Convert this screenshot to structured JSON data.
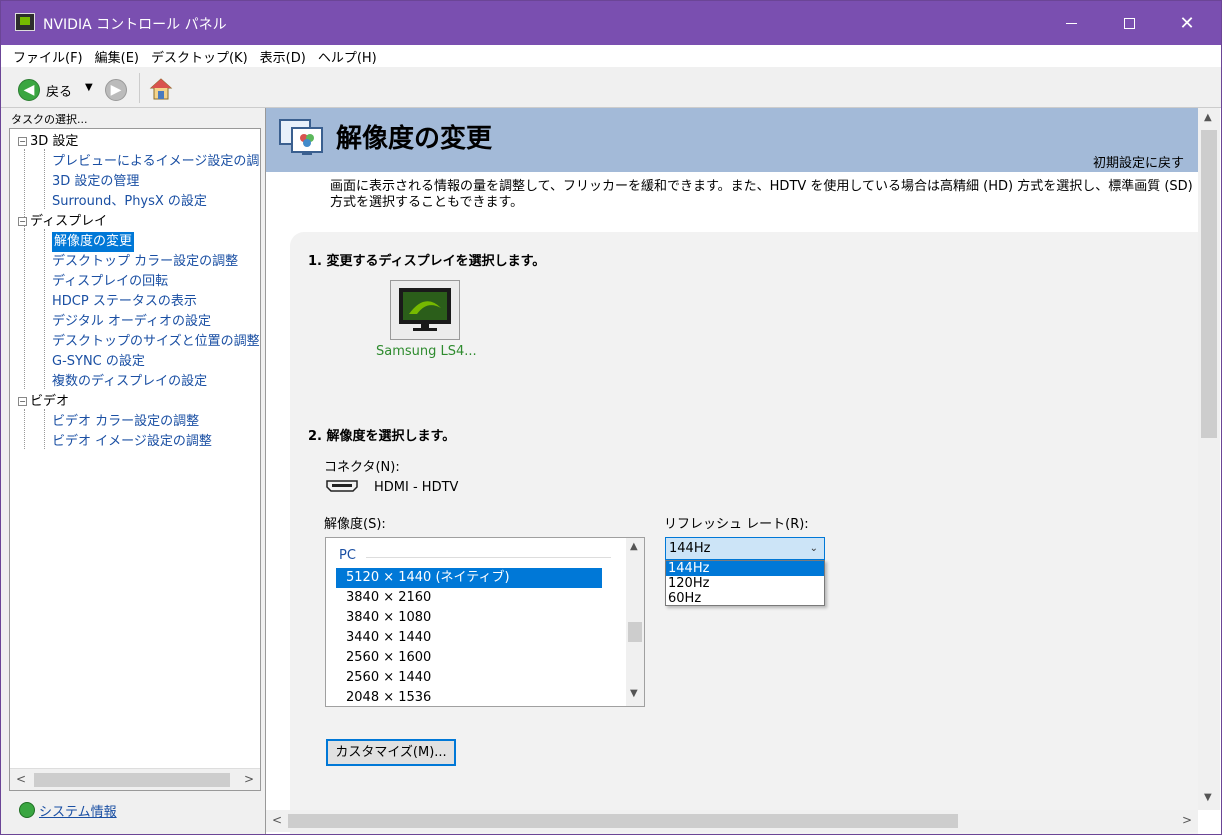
{
  "window": {
    "title": "NVIDIA コントロール パネル",
    "close_glyph": "✕"
  },
  "menu": [
    "ファイル(F)",
    "編集(E)",
    "デスクトップ(K)",
    "表示(D)",
    "ヘルプ(H)"
  ],
  "toolbar": {
    "back_label": "戻る"
  },
  "tasks": {
    "label": "タスクの選択...",
    "tree": [
      {
        "label": "3D 設定",
        "type": "category"
      },
      {
        "label": "プレビューによるイメージ設定の調整",
        "type": "link"
      },
      {
        "label": "3D 設定の管理",
        "type": "link"
      },
      {
        "label": "Surround、PhysX の設定",
        "type": "link"
      },
      {
        "label": "ディスプレイ",
        "type": "category"
      },
      {
        "label": "解像度の変更",
        "type": "link",
        "selected": true
      },
      {
        "label": "デスクトップ カラー設定の調整",
        "type": "link"
      },
      {
        "label": "ディスプレイの回転",
        "type": "link"
      },
      {
        "label": "HDCP ステータスの表示",
        "type": "link"
      },
      {
        "label": "デジタル オーディオの設定",
        "type": "link"
      },
      {
        "label": "デスクトップのサイズと位置の調整",
        "type": "link"
      },
      {
        "label": "G-SYNC の設定",
        "type": "link"
      },
      {
        "label": "複数のディスプレイの設定",
        "type": "link"
      },
      {
        "label": "ビデオ",
        "type": "category"
      },
      {
        "label": "ビデオ カラー設定の調整",
        "type": "link"
      },
      {
        "label": "ビデオ イメージ設定の調整",
        "type": "link"
      }
    ],
    "system_info": "システム情報"
  },
  "page": {
    "title": "解像度の変更",
    "reset_link": "初期設定に戻す",
    "description": "画面に表示される情報の量を調整して、フリッカーを緩和できます。また、HDTV を使用している場合は高精細 (HD) 方式を選択し、標準画質 (SD) 方式を選択することもできます。",
    "step1": "1. 変更するディスプレイを選択します。",
    "display_name": "Samsung LS4...",
    "step2": "2. 解像度を選択します。",
    "connector_label": "コネクタ(N):",
    "connector_value": "HDMI - HDTV",
    "resolution_label": "解像度(S):",
    "resolution_group": "PC",
    "resolutions": [
      "5120 × 1440 (ネイティブ)",
      "3840 × 2160",
      "3840 × 1080",
      "3440 × 1440",
      "2560 × 1600",
      "2560 × 1440",
      "2048 × 1536"
    ],
    "selected_resolution": "5120 × 1440 (ネイティブ)",
    "refresh_label": "リフレッシュ レート(R):",
    "refresh_selected": "144Hz",
    "refresh_options": [
      "144Hz",
      "120Hz",
      "60Hz"
    ],
    "customize_button": "カスタマイズ(M)..."
  },
  "colors": {
    "title_bar": "#7a4fb0",
    "banner": "#a3bad8",
    "selection": "#0078d7",
    "link": "#1a4fa3",
    "nvidia_green": "#76b900"
  }
}
